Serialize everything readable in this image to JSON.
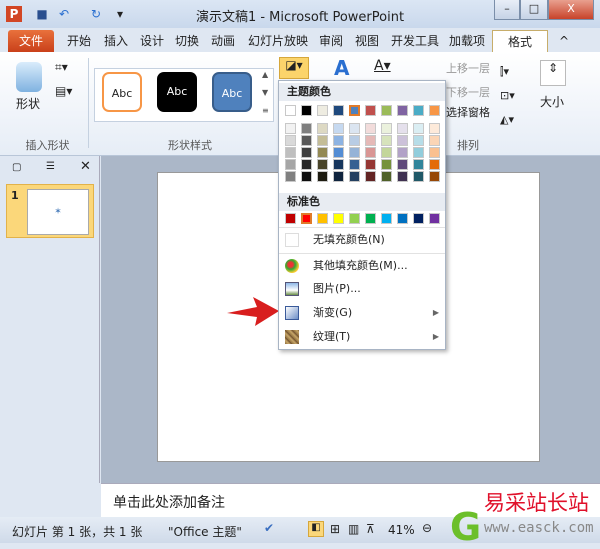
{
  "window": {
    "title": "演示文稿1 - Microsoft PowerPoint",
    "minimize": "–",
    "maximize": "□",
    "close": "X"
  },
  "tabs": [
    {
      "label": "文件"
    },
    {
      "label": "开始"
    },
    {
      "label": "插入"
    },
    {
      "label": "设计"
    },
    {
      "label": "切换"
    },
    {
      "label": "动画"
    },
    {
      "label": "幻灯片放映"
    },
    {
      "label": "审阅"
    },
    {
      "label": "视图"
    },
    {
      "label": "开发工具"
    },
    {
      "label": "加载项"
    },
    {
      "label": "格式"
    }
  ],
  "ribbon": {
    "shapes_label": "形状",
    "insert_shapes_group": "插入形状",
    "shape_styles_group": "形状样式",
    "styles": [
      {
        "label": "Abc"
      },
      {
        "label": "Abc"
      },
      {
        "label": "Abc"
      }
    ],
    "bring_forward": "上移一层",
    "send_backward": "下移一层",
    "selection_pane": "选择窗格",
    "arrange_group": "排列",
    "size_label": "大小"
  },
  "menu": {
    "theme_colors_label": "主题颜色",
    "standard_colors_label": "标准色",
    "theme_colors": [
      "#ffffff",
      "#000000",
      "#eeece1",
      "#1f497d",
      "#4f81bd",
      "#c0504d",
      "#9bbb59",
      "#8064a2",
      "#4bacc6",
      "#f79646"
    ],
    "theme_shades": [
      [
        "#f2f2f2",
        "#d9d9d9",
        "#bfbfbf",
        "#a6a6a6",
        "#808080"
      ],
      [
        "#7f7f7f",
        "#595959",
        "#3f3f3f",
        "#262626",
        "#0d0d0d"
      ],
      [
        "#ddd9c3",
        "#c4bd97",
        "#938953",
        "#494429",
        "#1d1b10"
      ],
      [
        "#c6d9f0",
        "#8db3e2",
        "#548dd4",
        "#17365d",
        "#0f243e"
      ],
      [
        "#dbe5f1",
        "#b8cce4",
        "#95b3d7",
        "#366092",
        "#244061"
      ],
      [
        "#f2dcdb",
        "#e5b9b7",
        "#d99694",
        "#953734",
        "#632423"
      ],
      [
        "#ebf1dd",
        "#d7e3bc",
        "#c3d69b",
        "#76923c",
        "#4f6128"
      ],
      [
        "#e5e0ec",
        "#ccc1d9",
        "#b2a2c7",
        "#5f497a",
        "#3f3151"
      ],
      [
        "#dbeef3",
        "#b7dde8",
        "#92cddc",
        "#31859b",
        "#205867"
      ],
      [
        "#fdeada",
        "#fbd5b5",
        "#fac08f",
        "#e36c09",
        "#974806"
      ]
    ],
    "standard_colors": [
      "#c00000",
      "#ff0000",
      "#ffc000",
      "#ffff00",
      "#92d050",
      "#00b050",
      "#00b0f0",
      "#0070c0",
      "#002060",
      "#7030a0"
    ],
    "items": [
      {
        "label": "无填充颜色(N)"
      },
      {
        "label": "其他填充颜色(M)..."
      },
      {
        "label": "图片(P)..."
      },
      {
        "label": "渐变(G)",
        "submenu": true
      },
      {
        "label": "纹理(T)",
        "submenu": true
      }
    ]
  },
  "slides": [
    {
      "number": "1"
    }
  ],
  "notes": {
    "placeholder": "单击此处添加备注"
  },
  "status": {
    "slide_info": "幻灯片 第 1 张，共 1 张",
    "theme": "\"Office 主题\"",
    "zoom": "41%"
  },
  "watermark": {
    "text": "易采站长站",
    "url": "www.easck.com"
  }
}
